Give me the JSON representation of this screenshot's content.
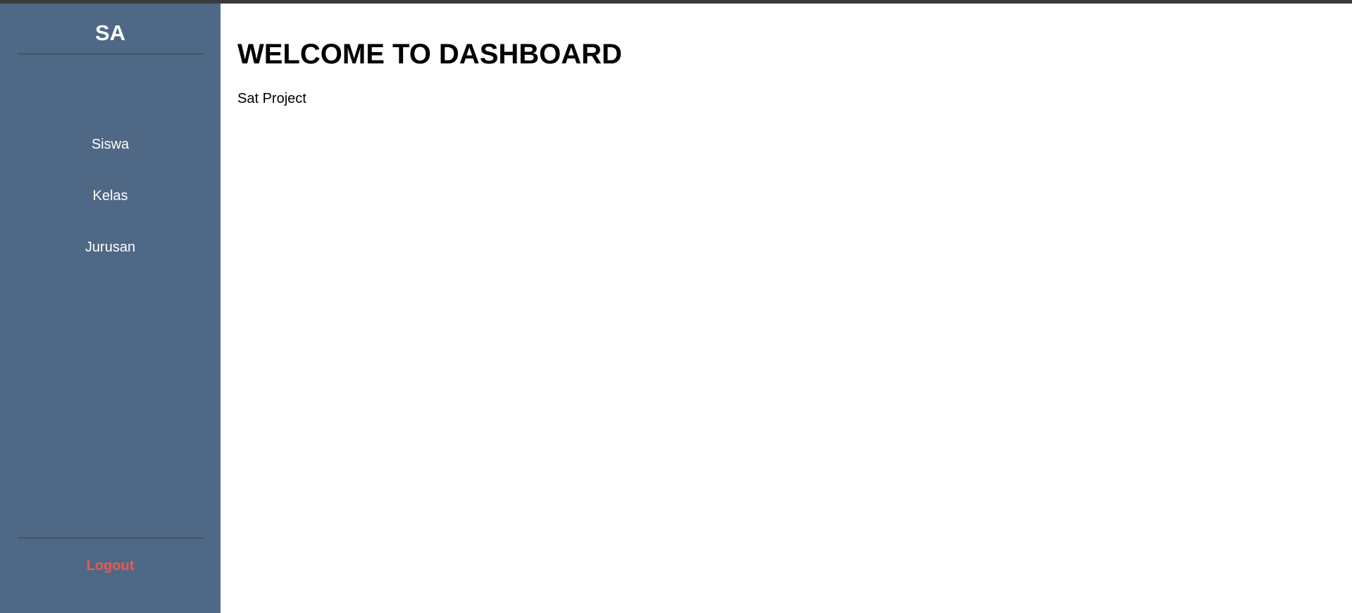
{
  "sidebar": {
    "brand": "SA",
    "items": [
      {
        "label": "Siswa"
      },
      {
        "label": "Kelas"
      },
      {
        "label": "Jurusan"
      }
    ],
    "logout_label": "Logout"
  },
  "main": {
    "title": "WELCOME TO DASHBOARD",
    "subtitle": "Sat Project"
  },
  "colors": {
    "sidebar_bg": "#4f6885",
    "logout_text": "#e85a4f",
    "top_bar": "#3a3a3a"
  }
}
